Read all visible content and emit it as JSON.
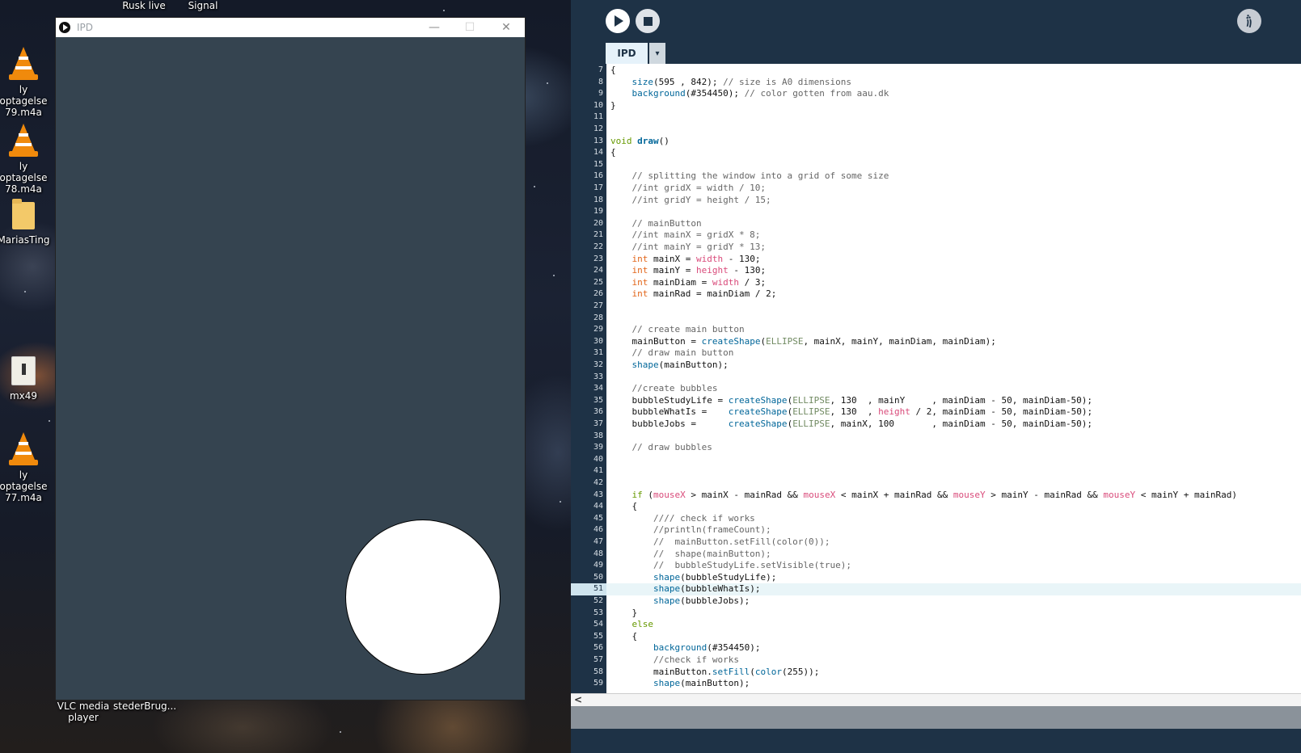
{
  "desktop": {
    "top_icons": [
      "Rusk live",
      "Signal"
    ],
    "icons": [
      {
        "label": "ly optagelse 79.m4a",
        "type": "vlc-file"
      },
      {
        "label": "ly optagelse 78.m4a",
        "type": "vlc-file"
      },
      {
        "label": "MariasTing",
        "type": "folder"
      },
      {
        "label": "mx49",
        "type": "zip-folder"
      },
      {
        "label": "ly optagelse 77.m4a",
        "type": "vlc-file"
      }
    ],
    "bottom_icons": [
      "VLC media player",
      "stederBrug..."
    ]
  },
  "sketch_window": {
    "title": "IPD",
    "background": "#354450",
    "controls": {
      "minimize": "—",
      "maximize": "☐",
      "close": "✕"
    }
  },
  "ide": {
    "tab": "IPD",
    "tab_menu": "▾",
    "mode_glyph": "꩞",
    "scroll_left": "<",
    "current_line": 51,
    "code": [
      {
        "n": 7,
        "t": [
          {
            "c": "",
            "s": "{"
          }
        ]
      },
      {
        "n": 8,
        "t": [
          {
            "c": "",
            "s": "    "
          },
          {
            "c": "kw-fn",
            "s": "size"
          },
          {
            "c": "",
            "s": "(595 , 842); "
          },
          {
            "c": "cmt",
            "s": "// size is A0 dimensions"
          }
        ]
      },
      {
        "n": 9,
        "t": [
          {
            "c": "",
            "s": "    "
          },
          {
            "c": "kw-fn",
            "s": "background"
          },
          {
            "c": "",
            "s": "(#354450); "
          },
          {
            "c": "cmt",
            "s": "// color gotten from aau.dk"
          }
        ]
      },
      {
        "n": 10,
        "t": [
          {
            "c": "",
            "s": "}"
          }
        ]
      },
      {
        "n": 11,
        "t": []
      },
      {
        "n": 12,
        "t": []
      },
      {
        "n": 13,
        "t": [
          {
            "c": "kw-ctrl",
            "s": "void"
          },
          {
            "c": "",
            "s": " "
          },
          {
            "c": "kw-fn bold",
            "s": "draw"
          },
          {
            "c": "",
            "s": "()"
          }
        ]
      },
      {
        "n": 14,
        "t": [
          {
            "c": "",
            "s": "{"
          }
        ]
      },
      {
        "n": 15,
        "t": []
      },
      {
        "n": 16,
        "t": [
          {
            "c": "cmt",
            "s": "    // splitting the window into a grid of some size"
          }
        ]
      },
      {
        "n": 17,
        "t": [
          {
            "c": "cmt",
            "s": "    //int gridX = width / 10;"
          }
        ]
      },
      {
        "n": 18,
        "t": [
          {
            "c": "cmt",
            "s": "    //int gridY = height / 15;"
          }
        ]
      },
      {
        "n": 19,
        "t": []
      },
      {
        "n": 20,
        "t": [
          {
            "c": "cmt",
            "s": "    // mainButton"
          }
        ]
      },
      {
        "n": 21,
        "t": [
          {
            "c": "cmt",
            "s": "    //int mainX = gridX * 8;"
          }
        ]
      },
      {
        "n": 22,
        "t": [
          {
            "c": "cmt",
            "s": "    //int mainY = gridY * 13;"
          }
        ]
      },
      {
        "n": 23,
        "t": [
          {
            "c": "",
            "s": "    "
          },
          {
            "c": "kw-type",
            "s": "int"
          },
          {
            "c": "",
            "s": " mainX = "
          },
          {
            "c": "kw-var",
            "s": "width"
          },
          {
            "c": "",
            "s": " - 130;"
          }
        ]
      },
      {
        "n": 24,
        "t": [
          {
            "c": "",
            "s": "    "
          },
          {
            "c": "kw-type",
            "s": "int"
          },
          {
            "c": "",
            "s": " mainY = "
          },
          {
            "c": "kw-var",
            "s": "height"
          },
          {
            "c": "",
            "s": " - 130;"
          }
        ]
      },
      {
        "n": 25,
        "t": [
          {
            "c": "",
            "s": "    "
          },
          {
            "c": "kw-type",
            "s": "int"
          },
          {
            "c": "",
            "s": " mainDiam = "
          },
          {
            "c": "kw-var",
            "s": "width"
          },
          {
            "c": "",
            "s": " / 3;"
          }
        ]
      },
      {
        "n": 26,
        "t": [
          {
            "c": "",
            "s": "    "
          },
          {
            "c": "kw-type",
            "s": "int"
          },
          {
            "c": "",
            "s": " mainRad = mainDiam / 2;"
          }
        ]
      },
      {
        "n": 27,
        "t": []
      },
      {
        "n": 28,
        "t": []
      },
      {
        "n": 29,
        "t": [
          {
            "c": "cmt",
            "s": "    // create main button"
          }
        ]
      },
      {
        "n": 30,
        "t": [
          {
            "c": "",
            "s": "    mainButton = "
          },
          {
            "c": "kw-fn",
            "s": "createShape"
          },
          {
            "c": "",
            "s": "("
          },
          {
            "c": "kw-const",
            "s": "ELLIPSE"
          },
          {
            "c": "",
            "s": ", mainX, mainY, mainDiam, mainDiam);"
          }
        ]
      },
      {
        "n": 31,
        "t": [
          {
            "c": "cmt",
            "s": "    // draw main button"
          }
        ]
      },
      {
        "n": 32,
        "t": [
          {
            "c": "",
            "s": "    "
          },
          {
            "c": "kw-fn",
            "s": "shape"
          },
          {
            "c": "",
            "s": "(mainButton);"
          }
        ]
      },
      {
        "n": 33,
        "t": []
      },
      {
        "n": 34,
        "t": [
          {
            "c": "cmt",
            "s": "    //create bubbles"
          }
        ]
      },
      {
        "n": 35,
        "t": [
          {
            "c": "",
            "s": "    bubbleStudyLife = "
          },
          {
            "c": "kw-fn",
            "s": "createShape"
          },
          {
            "c": "",
            "s": "("
          },
          {
            "c": "kw-const",
            "s": "ELLIPSE"
          },
          {
            "c": "",
            "s": ", 130  , mainY     , mainDiam - 50, mainDiam-50);"
          }
        ]
      },
      {
        "n": 36,
        "t": [
          {
            "c": "",
            "s": "    bubbleWhatIs =    "
          },
          {
            "c": "kw-fn",
            "s": "createShape"
          },
          {
            "c": "",
            "s": "("
          },
          {
            "c": "kw-const",
            "s": "ELLIPSE"
          },
          {
            "c": "",
            "s": ", 130  , "
          },
          {
            "c": "kw-var",
            "s": "height"
          },
          {
            "c": "",
            "s": " / 2, mainDiam - 50, mainDiam-50);"
          }
        ]
      },
      {
        "n": 37,
        "t": [
          {
            "c": "",
            "s": "    bubbleJobs =      "
          },
          {
            "c": "kw-fn",
            "s": "createShape"
          },
          {
            "c": "",
            "s": "("
          },
          {
            "c": "kw-const",
            "s": "ELLIPSE"
          },
          {
            "c": "",
            "s": ", mainX, 100       , mainDiam - 50, mainDiam-50);"
          }
        ]
      },
      {
        "n": 38,
        "t": []
      },
      {
        "n": 39,
        "t": [
          {
            "c": "cmt",
            "s": "    // draw bubbles"
          }
        ]
      },
      {
        "n": 40,
        "t": []
      },
      {
        "n": 41,
        "t": []
      },
      {
        "n": 42,
        "t": []
      },
      {
        "n": 43,
        "t": [
          {
            "c": "",
            "s": "    "
          },
          {
            "c": "kw-ctrl",
            "s": "if"
          },
          {
            "c": "",
            "s": " ("
          },
          {
            "c": "kw-var",
            "s": "mouseX"
          },
          {
            "c": "",
            "s": " > mainX - mainRad && "
          },
          {
            "c": "kw-var",
            "s": "mouseX"
          },
          {
            "c": "",
            "s": " < mainX + mainRad && "
          },
          {
            "c": "kw-var",
            "s": "mouseY"
          },
          {
            "c": "",
            "s": " > mainY - mainRad && "
          },
          {
            "c": "kw-var",
            "s": "mouseY"
          },
          {
            "c": "",
            "s": " < mainY + mainRad)"
          }
        ]
      },
      {
        "n": 44,
        "t": [
          {
            "c": "",
            "s": "    {"
          }
        ]
      },
      {
        "n": 45,
        "t": [
          {
            "c": "cmt",
            "s": "        //// check if works"
          }
        ]
      },
      {
        "n": 46,
        "t": [
          {
            "c": "cmt",
            "s": "        //println(frameCount);"
          }
        ]
      },
      {
        "n": 47,
        "t": [
          {
            "c": "cmt",
            "s": "        //  mainButton.setFill(color(0));"
          }
        ]
      },
      {
        "n": 48,
        "t": [
          {
            "c": "cmt",
            "s": "        //  shape(mainButton);"
          }
        ]
      },
      {
        "n": 49,
        "t": [
          {
            "c": "cmt",
            "s": "        //  bubbleStudyLife.setVisible(true);"
          }
        ]
      },
      {
        "n": 50,
        "t": [
          {
            "c": "",
            "s": "        "
          },
          {
            "c": "kw-fn",
            "s": "shape"
          },
          {
            "c": "",
            "s": "(bubbleStudyLife);"
          }
        ]
      },
      {
        "n": 51,
        "t": [
          {
            "c": "",
            "s": "        "
          },
          {
            "c": "kw-fn",
            "s": "shape"
          },
          {
            "c": "",
            "s": "(bubbleWhatIs);"
          }
        ]
      },
      {
        "n": 52,
        "t": [
          {
            "c": "",
            "s": "        "
          },
          {
            "c": "kw-fn",
            "s": "shape"
          },
          {
            "c": "",
            "s": "(bubbleJobs);"
          }
        ]
      },
      {
        "n": 53,
        "t": [
          {
            "c": "",
            "s": "    }"
          }
        ]
      },
      {
        "n": 54,
        "t": [
          {
            "c": "",
            "s": "    "
          },
          {
            "c": "kw-ctrl",
            "s": "else"
          }
        ]
      },
      {
        "n": 55,
        "t": [
          {
            "c": "",
            "s": "    {"
          }
        ]
      },
      {
        "n": 56,
        "t": [
          {
            "c": "",
            "s": "        "
          },
          {
            "c": "kw-fn",
            "s": "background"
          },
          {
            "c": "",
            "s": "(#354450);"
          }
        ]
      },
      {
        "n": 57,
        "t": [
          {
            "c": "cmt",
            "s": "        //check if works"
          }
        ]
      },
      {
        "n": 58,
        "t": [
          {
            "c": "",
            "s": "        mainButton."
          },
          {
            "c": "kw-fn",
            "s": "setFill"
          },
          {
            "c": "",
            "s": "("
          },
          {
            "c": "kw-fn",
            "s": "color"
          },
          {
            "c": "",
            "s": "(255));"
          }
        ]
      },
      {
        "n": 59,
        "t": [
          {
            "c": "",
            "s": "        "
          },
          {
            "c": "kw-fn",
            "s": "shape"
          },
          {
            "c": "",
            "s": "(mainButton);"
          }
        ]
      }
    ]
  }
}
